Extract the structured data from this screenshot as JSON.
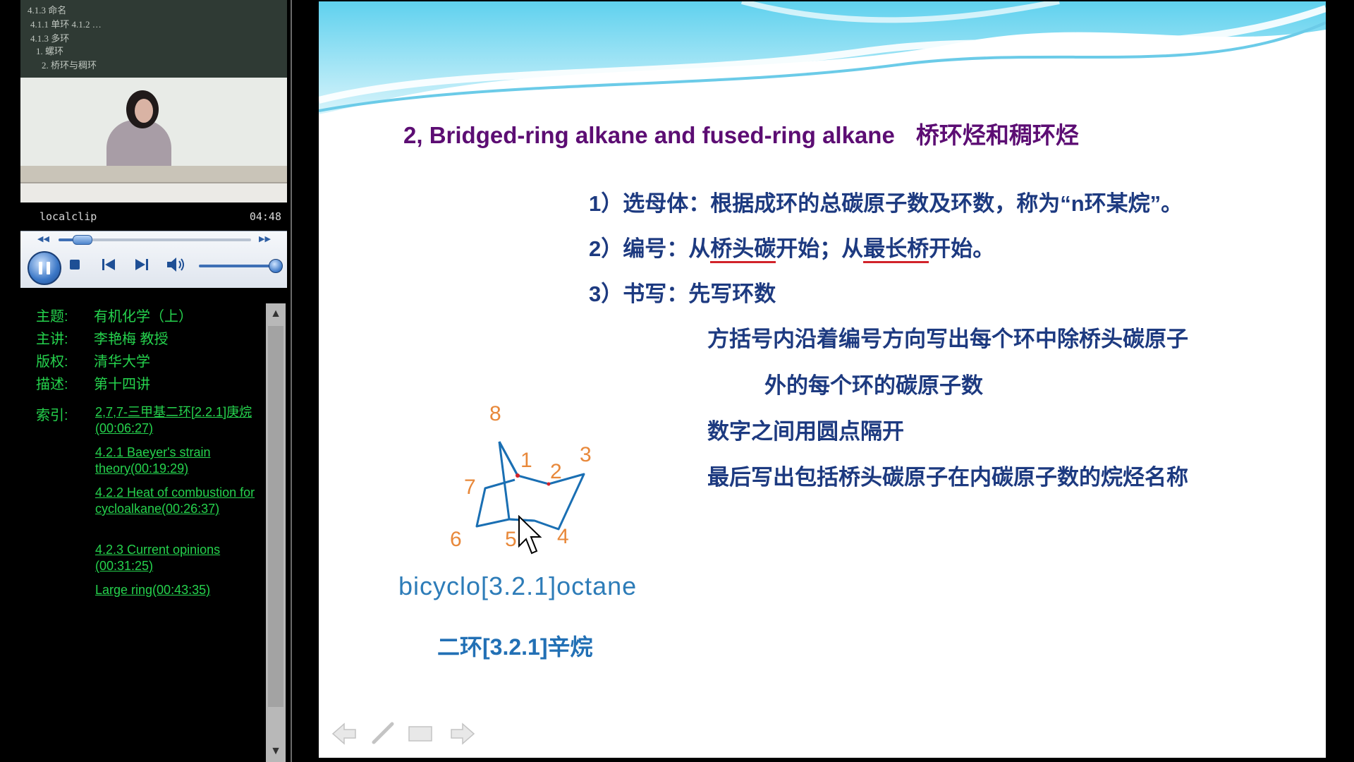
{
  "player": {
    "clip_name": "localclip",
    "clip_time": "04:48",
    "seek_progress": 0.11,
    "volume": 1.0
  },
  "video": {
    "board_lines": [
      "4.1.3 命名",
      "4.1.1 单环 4.1.2 …",
      "4.1.3 多环",
      "1. 螺环",
      "2. 桥环与稠环"
    ]
  },
  "info": {
    "topic_key": "主题:",
    "topic": "有机化学（上）",
    "lecturer_key": "主讲:",
    "lecturer": "李艳梅 教授",
    "copyright_key": "版权:",
    "copyright": "清华大学",
    "desc_key": "描述:",
    "desc": "第十四讲",
    "index_key": "索引:",
    "index": [
      "2,7,7-三甲基二环[2.2.1]庚烷(00:06:27)",
      "4.2.1 Baeyer's strain theory(00:19:29)",
      "4.2.2 Heat of combustion for cycloalkane(00:26:37)",
      "4.2.3 Current opinions (00:31:25)",
      "Large ring(00:43:35)"
    ]
  },
  "slide": {
    "title_en": "2, Bridged-ring alkane and fused-ring alkane",
    "title_cn": "桥环烃和稠环烃",
    "rule1": "1）选母体：根据成环的总碳原子数及环数，称为“n环某烷”。",
    "rule2_a": "2）编号：从",
    "rule2_b": "桥头碳",
    "rule2_c": "开始；从",
    "rule2_d": "最长桥",
    "rule2_e": "开始。",
    "rule3": "3）书写：先写环数",
    "rule3_a": "方括号内沿着编号方向写出每个环中除桥头碳原子",
    "rule3_b": "外的每个环的碳原子数",
    "rule3_c": "数字之间用圆点隔开",
    "rule3_d": "最后写出包括桥头碳原子在内碳原子数的烷烃名称",
    "atom_labels": [
      "8",
      "1",
      "2",
      "3",
      "7",
      "6",
      "5",
      "4"
    ],
    "molecule_name": "bicyclo[3.2.1]octane",
    "molecule_cn": "二环[3.2.1]辛烷",
    "colors": {
      "title": "#5c0d73",
      "text": "#1d3a80",
      "atom_labels": "#e8883a",
      "underline": "#d2232a"
    }
  }
}
